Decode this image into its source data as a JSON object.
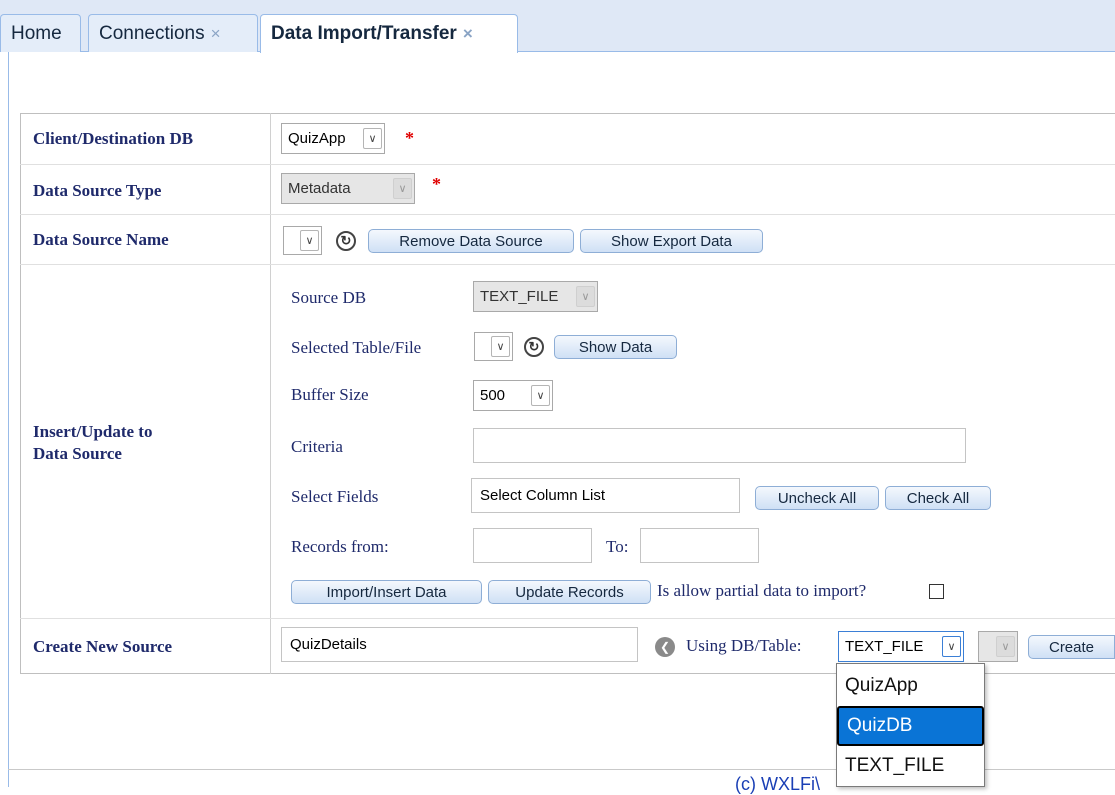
{
  "tabs": [
    {
      "label": "Home",
      "closable": false
    },
    {
      "label": "Connections",
      "closable": true
    },
    {
      "label": "Data Import/Transfer",
      "closable": true,
      "active": true
    }
  ],
  "close_glyph": "×",
  "form": {
    "client_db": {
      "label": "Client/Destination DB",
      "value": "QuizApp",
      "required": "*"
    },
    "source_type": {
      "label": "Data Source Type",
      "value": "Metadata",
      "required": "*"
    },
    "source_name": {
      "label": "Data Source Name",
      "value": "",
      "remove_btn": "Remove Data Source",
      "export_btn": "Show Export Data"
    },
    "insert_update": {
      "label_line1": "Insert/Update to",
      "label_line2": "Data Source",
      "source_db": {
        "label": "Source DB",
        "value": "TEXT_FILE"
      },
      "selected_table": {
        "label": "Selected Table/File",
        "value": "",
        "show_btn": "Show Data"
      },
      "buffer_size": {
        "label": "Buffer Size",
        "value": "500"
      },
      "criteria": {
        "label": "Criteria",
        "value": ""
      },
      "select_fields": {
        "label": "Select Fields",
        "value": "Select Column List",
        "uncheck_btn": "Uncheck All",
        "check_btn": "Check All"
      },
      "records_from": {
        "label": "Records from:",
        "value": "",
        "to_label": "To:",
        "to_value": ""
      },
      "import_btn": "Import/Insert Data",
      "update_btn": "Update Records",
      "partial_label": "Is allow partial data to import?",
      "partial_checked": false
    },
    "create_source": {
      "label": "Create New Source",
      "value": "QuizDetails",
      "using_label": "Using DB/Table:",
      "db_value": "TEXT_FILE",
      "table_value": "",
      "create_btn": "Create"
    }
  },
  "dropdown": {
    "options": [
      "QuizApp",
      "QuizDB",
      "TEXT_FILE"
    ],
    "highlighted": "QuizDB"
  },
  "footer": {
    "text": "(c) WXLFi\\"
  },
  "colors": {
    "label": "#1f2a6b",
    "required": "#e00000",
    "highlight": "#0a74d6",
    "tab_border": "#99bbe8"
  },
  "icons": {
    "refresh": "refresh-icon",
    "nav": "chevron-left-circle-icon",
    "dropdown_arrow": "chevron-down-icon"
  }
}
